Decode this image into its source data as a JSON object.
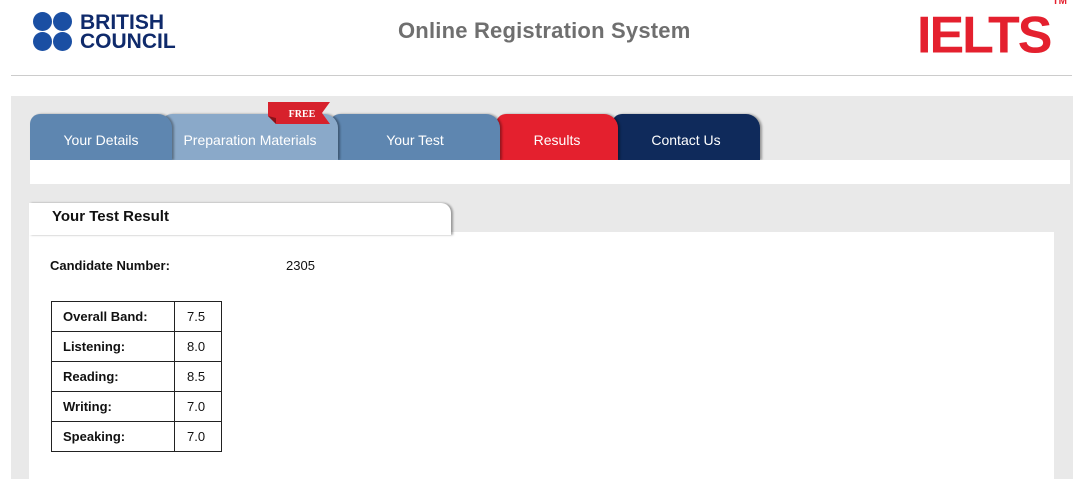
{
  "header": {
    "logo_left": "BRITISH COUNCIL",
    "logo_left_line1": "BRITISH",
    "logo_left_line2": "COUNCIL",
    "title": "Online Registration System",
    "logo_right": "IELTS",
    "logo_right_mark": "TM"
  },
  "tabs": [
    {
      "label": "Your Details",
      "color": "#5e86b0"
    },
    {
      "label": "Preparation Materials",
      "color": "#8aa9c9",
      "badge": "FREE"
    },
    {
      "label": "Your Test",
      "color": "#5e86b0"
    },
    {
      "label": "Results",
      "color": "#e4202e",
      "active": true
    },
    {
      "label": "Contact Us",
      "color": "#0f2a5b"
    }
  ],
  "result": {
    "title": "Your Test Result",
    "candidate_label": "Candidate Number:",
    "candidate_value": "2305",
    "scores": [
      {
        "label": "Overall Band:",
        "value": "7.5"
      },
      {
        "label": "Listening:",
        "value": "8.0"
      },
      {
        "label": "Reading:",
        "value": "8.5"
      },
      {
        "label": "Writing:",
        "value": "7.0"
      },
      {
        "label": "Speaking:",
        "value": "7.0"
      }
    ]
  },
  "colors": {
    "british_council_blue": "#1a4fa3",
    "ielts_red": "#e4202e",
    "tab_blue": "#5e86b0",
    "tab_navy": "#0f2a5b"
  }
}
